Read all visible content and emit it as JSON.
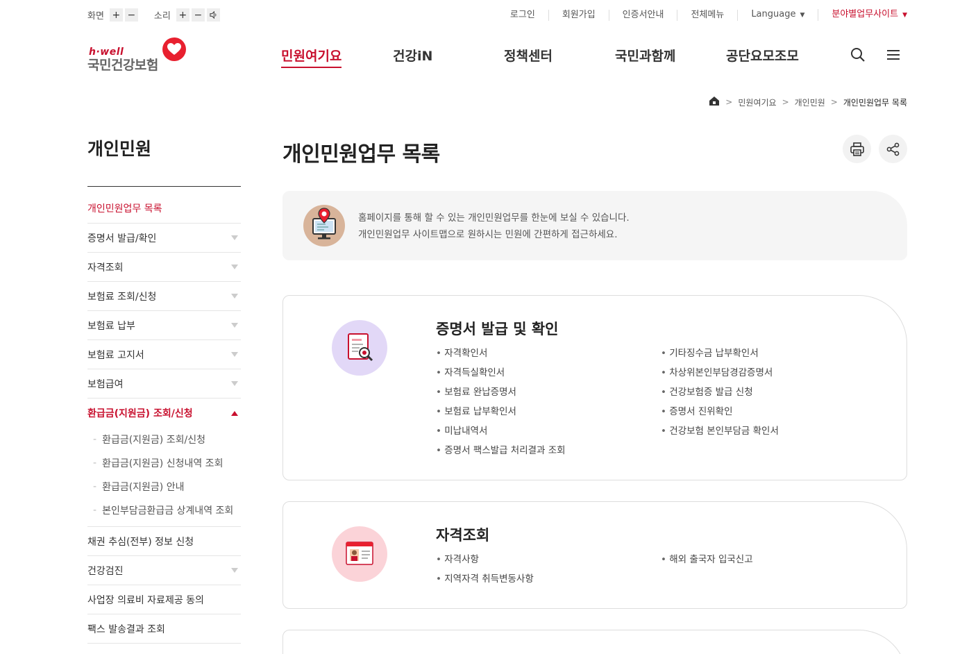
{
  "util": {
    "screen_label": "화면",
    "sound_label": "소리",
    "plus": "+",
    "minus": "−"
  },
  "topnav": {
    "items": [
      "로그인",
      "회원가입",
      "인증서안내",
      "전체메뉴",
      "Language",
      "분야별업무사이트"
    ]
  },
  "logo": {
    "tagline": "h·well",
    "name": "국민건강보험"
  },
  "gnb": {
    "items": [
      "민원여기요",
      "건강iN",
      "정책센터",
      "국민과함께",
      "공단요모조모"
    ],
    "active_index": 0
  },
  "breadcrumb": {
    "items": [
      "민원여기요",
      "개인민원",
      "개인민원업무 목록"
    ]
  },
  "lnb": {
    "title": "개인민원",
    "items": [
      "개인민원업무 목록",
      "증명서 발급/확인",
      "자격조회",
      "보험료 조회/신청",
      "보험료 납부",
      "보험료 고지서",
      "보험급여",
      "환급금(지원금) 조회/신청",
      "채권 추심(전부) 정보 신청",
      "건강검진",
      "사업장 의료비 자료제공 동의",
      "팩스 발송결과 조회"
    ],
    "subitems": [
      "환급금(지원금) 조회/신청",
      "환급금(지원금) 신청내역 조회",
      "환급금(지원금) 안내",
      "본인부담금환급금 상계내역 조회"
    ]
  },
  "main": {
    "title": "개인민원업무 목록",
    "intro_line1": "홈페이지를 통해 할 수 있는 개인민원업무를 한눈에 보실 수 있습니다.",
    "intro_line2": "개인민원업무 사이트맵으로 원하시는 민원에 간편하게 접근하세요."
  },
  "cards": [
    {
      "title": "증명서 발급 및 확인",
      "col1": [
        "자격확인서",
        "자격득실확인서",
        "보험료 완납증명서",
        "보험료 납부확인서",
        "미납내역서",
        "증명서 팩스발급 처리결과 조회"
      ],
      "col2": [
        "기타징수금 납부확인서",
        "차상위본인부담경감증명서",
        "건강보험증 발급 신청",
        "증명서 진위확인",
        "건강보험 본인부담금 확인서"
      ]
    },
    {
      "title": "자격조회",
      "col1": [
        "자격사항",
        "지역자격 취득변동사항"
      ],
      "col2": [
        "해외 출국자 입국신고"
      ]
    }
  ],
  "colors": {
    "brand_red": "#c8102e",
    "card1_icon_bg": "#e2d8f7",
    "card2_icon_bg": "#fbd3d8"
  }
}
